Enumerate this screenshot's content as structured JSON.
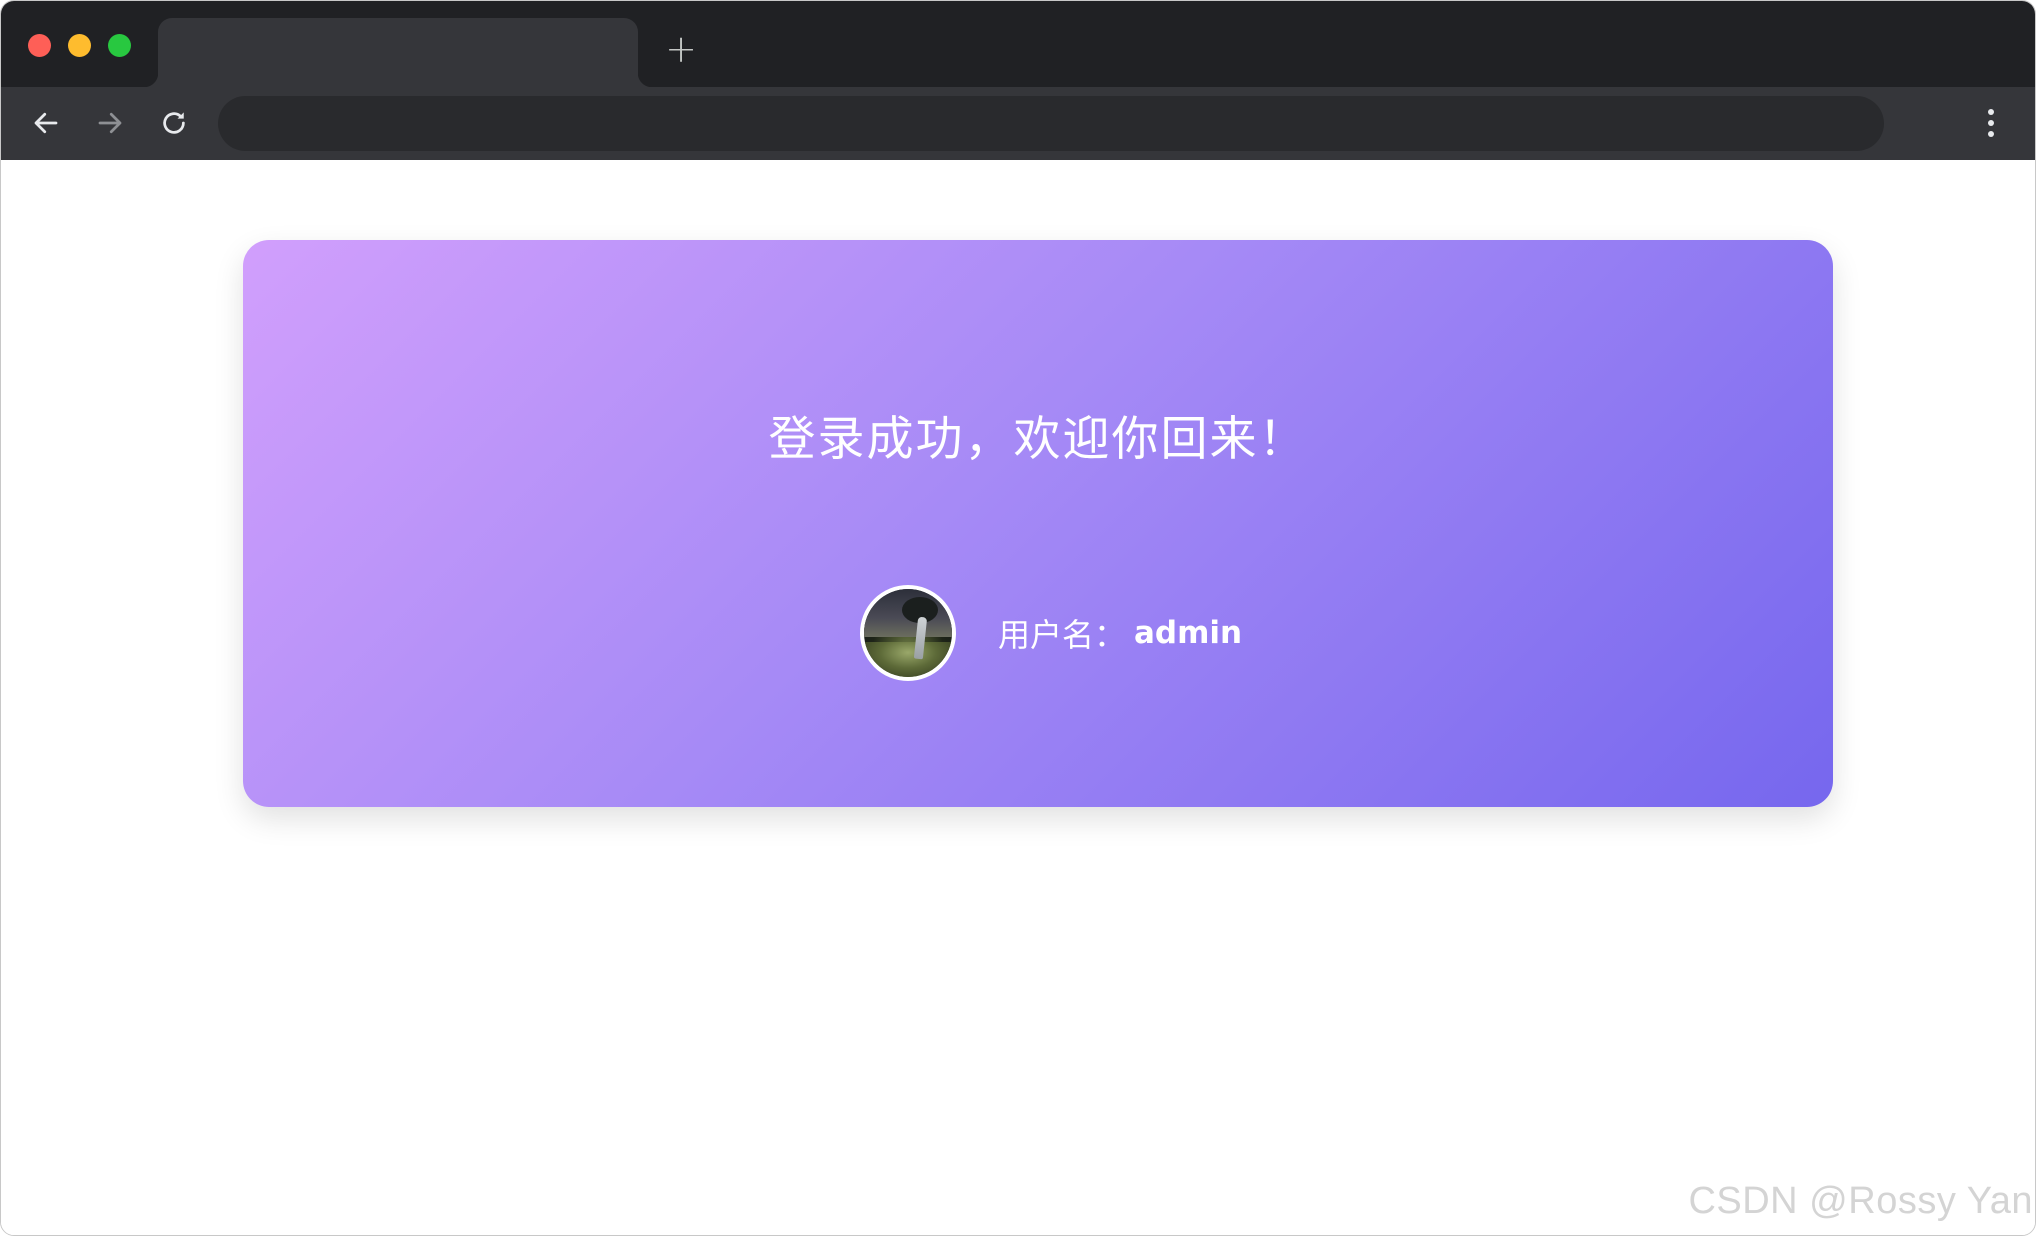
{
  "browser": {
    "new_tab_label": "+",
    "toolbar_icons": [
      "back-arrow-icon",
      "forward-arrow-icon",
      "reload-icon",
      "more-vert-icon"
    ],
    "window_controls": [
      "close",
      "minimize",
      "maximize"
    ]
  },
  "page": {
    "welcome_message": "登录成功，欢迎你回来！",
    "username_label": "用户名：",
    "username_value": "admin",
    "card_gradient": [
      "#d19ffc",
      "#7667ee"
    ]
  },
  "watermark": "CSDN @Rossy Yan"
}
